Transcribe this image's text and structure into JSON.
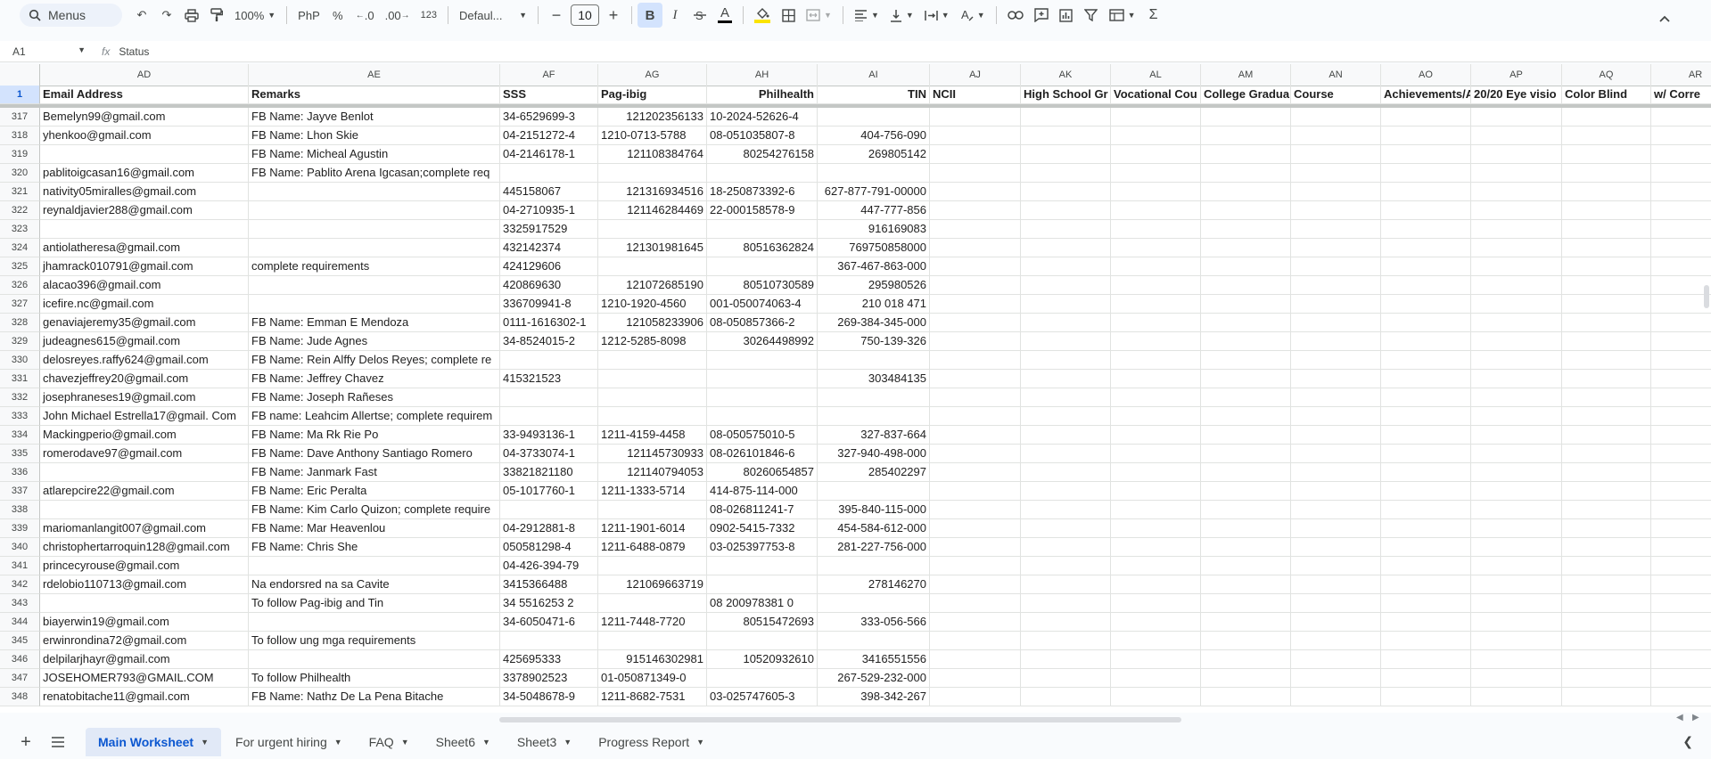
{
  "toolbar": {
    "menus_label": "Menus",
    "zoom": "100%",
    "currency": "PhP",
    "percent": "%",
    "dec_decrease": ".0",
    "dec_increase": ".00",
    "number_format": "123",
    "font_family": "Defaul...",
    "font_size": "10",
    "bold_label": "B",
    "italic_label": "I",
    "text_color_label": "A",
    "sum_label": "Σ"
  },
  "formula_bar": {
    "name_box": "A1",
    "fx_label": "fx",
    "content": "Status"
  },
  "columns": [
    "AD",
    "AE",
    "AF",
    "AG",
    "AH",
    "AI",
    "AJ",
    "AK",
    "AL",
    "AM",
    "AN",
    "AO",
    "AP",
    "AQ",
    "AR"
  ],
  "header_row": {
    "row_number": "1",
    "cells": [
      "Email Address",
      "Remarks",
      "SSS",
      "Pag-ibig",
      "Philhealth",
      "TIN",
      "NCII",
      "High School Gr",
      "Vocational Cou",
      "College Gradua",
      "Course",
      "Achievements/A",
      "20/20 Eye visio",
      "Color Blind",
      "w/ Corre"
    ]
  },
  "rows": [
    {
      "n": "317",
      "email": "Bemelyn99@gmail.com",
      "remarks": "FB Name: Jayve Benlot",
      "sss": "34-6529699-3",
      "pagibig": "121202356133",
      "philhealth": "10-2024-52626-4",
      "tin": ""
    },
    {
      "n": "318",
      "email": "yhenkoo@gmail.com",
      "remarks": "FB Name: Lhon Skie",
      "sss": "04-2151272-4",
      "pagibig": "1210-0713-5788",
      "philhealth": "08-051035807-8",
      "tin": "404-756-090"
    },
    {
      "n": "319",
      "email": "",
      "remarks": "FB Name: Micheal Agustin",
      "sss": "04-2146178-1",
      "pagibig": "121108384764",
      "philhealth": "80254276158",
      "tin": "269805142"
    },
    {
      "n": "320",
      "email": "pablitoigcasan16@gmail.com",
      "remarks": "FB Name: Pablito Arena Igcasan;complete req",
      "sss": "",
      "pagibig": "",
      "philhealth": "",
      "tin": ""
    },
    {
      "n": "321",
      "email": "nativity05miralles@gmail.com",
      "remarks": "",
      "sss": "445158067",
      "pagibig": "121316934516",
      "philhealth": "18-250873392-6",
      "tin": "627-877-791-00000"
    },
    {
      "n": "322",
      "email": "reynaldjavier288@gmail.com",
      "remarks": "",
      "sss": "04-2710935-1",
      "pagibig": "121146284469",
      "philhealth": "22-000158578-9",
      "tin": "447-777-856"
    },
    {
      "n": "323",
      "email": "",
      "remarks": "",
      "sss": "3325917529",
      "pagibig": "",
      "philhealth": "",
      "tin": "916169083"
    },
    {
      "n": "324",
      "email": "antiolatheresa@gmail.com",
      "remarks": "",
      "sss": "432142374",
      "pagibig": "121301981645",
      "philhealth": "80516362824",
      "tin": "769750858000"
    },
    {
      "n": "325",
      "email": "jhamrack010791@gmail.com",
      "remarks": "complete requirements",
      "sss": "424129606",
      "pagibig": "",
      "philhealth": "",
      "tin": "367-467-863-000"
    },
    {
      "n": "326",
      "email": "alacao396@gmail.com",
      "remarks": "",
      "sss": "420869630",
      "pagibig": "121072685190",
      "philhealth": "80510730589",
      "tin": "295980526"
    },
    {
      "n": "327",
      "email": "icefire.nc@gmail.com",
      "remarks": "",
      "sss": "336709941-8",
      "pagibig": "1210-1920-4560",
      "philhealth": "001-050074063-4",
      "tin": "210 018 471"
    },
    {
      "n": "328",
      "email": "genaviajeremy35@gmail.com",
      "remarks": "FB Name: Emman E Mendoza",
      "sss": "0111-1616302-1",
      "pagibig": "121058233906",
      "philhealth": "08-050857366-2",
      "tin": "269-384-345-000"
    },
    {
      "n": "329",
      "email": "judeagnes615@gmail.com",
      "remarks": "FB Name: Jude Agnes",
      "sss": "34-8524015-2",
      "pagibig": "1212-5285-8098",
      "philhealth": "30264498992",
      "tin": "750-139-326"
    },
    {
      "n": "330",
      "email": "delosreyes.raffy624@gmail.com",
      "remarks": "FB Name: Rein Alffy Delos Reyes; complete re",
      "sss": "",
      "pagibig": "",
      "philhealth": "",
      "tin": ""
    },
    {
      "n": "331",
      "email": "chavezjeffrey20@gmail.com",
      "remarks": "FB Name: Jeffrey Chavez",
      "sss": "415321523",
      "pagibig": "",
      "philhealth": "",
      "tin": "303484135"
    },
    {
      "n": "332",
      "email": "josephraneses19@gmail.com",
      "remarks": "FB Name: Joseph Rañeses",
      "sss": "",
      "pagibig": "",
      "philhealth": "",
      "tin": ""
    },
    {
      "n": "333",
      "email": "John Michael Estrella17@gmail. Com",
      "remarks": "FB name: Leahcim Allertse; complete requirem",
      "sss": "",
      "pagibig": "",
      "philhealth": "",
      "tin": ""
    },
    {
      "n": "334",
      "email": "Mackingperio@gmail.com",
      "remarks": "FB Name: Ma Rk Rie Po",
      "sss": "33-9493136-1",
      "pagibig": "1211-4159-4458",
      "philhealth": "08-050575010-5",
      "tin": "327-837-664"
    },
    {
      "n": "335",
      "email": "romerodave97@gmail.com",
      "remarks": "FB Name: Dave Anthony Santiago Romero",
      "sss": "04-3733074-1",
      "pagibig": "121145730933",
      "philhealth": "08-026101846-6",
      "tin": "327-940-498-000"
    },
    {
      "n": "336",
      "email": "",
      "remarks": "FB Name: Janmark Fast",
      "sss": "33821821180",
      "pagibig": "121140794053",
      "philhealth": "80260654857",
      "tin": "285402297"
    },
    {
      "n": "337",
      "email": "atlarepcire22@gmail.com",
      "remarks": "FB Name: Eric Peralta",
      "sss": "05-1017760-1",
      "pagibig": "1211-1333-5714",
      "philhealth": "414-875-114-000",
      "tin": ""
    },
    {
      "n": "338",
      "email": "",
      "remarks": "FB Name: Kim Carlo Quizon; complete require",
      "sss": "",
      "pagibig": "",
      "philhealth": "08-026811241-7",
      "tin": "395-840-115-000"
    },
    {
      "n": "339",
      "email": "mariomanlangit007@gmail.com",
      "remarks": "FB Name: Mar Heavenlou",
      "sss": "04-2912881-8",
      "pagibig": "1211-1901-6014",
      "philhealth": "0902-5415-7332",
      "tin": "454-584-612-000"
    },
    {
      "n": "340",
      "email": "christophertarroquin128@gmail.com",
      "remarks": "FB Name: Chris She",
      "sss": "050581298-4",
      "pagibig": "1211-6488-0879",
      "philhealth": "03-025397753-8",
      "tin": "281-227-756-000"
    },
    {
      "n": "341",
      "email": "princecyrouse@gmail.com",
      "remarks": "",
      "sss": "04-426-394-79",
      "pagibig": "",
      "philhealth": "",
      "tin": ""
    },
    {
      "n": "342",
      "email": "rdelobio110713@gmail.com",
      "remarks": "Na endorsred na sa Cavite",
      "sss": "3415366488",
      "pagibig": "121069663719",
      "philhealth": "",
      "tin": "278146270"
    },
    {
      "n": "343",
      "email": "",
      "remarks": "To follow Pag-ibig and Tin",
      "sss": "34 5516253 2",
      "pagibig": "",
      "philhealth": "08 200978381 0",
      "tin": ""
    },
    {
      "n": "344",
      "email": "biayerwin19@gmail.com",
      "remarks": "",
      "sss": "34-6050471-6",
      "pagibig": "1211-7448-7720",
      "philhealth": "80515472693",
      "tin": "333-056-566"
    },
    {
      "n": "345",
      "email": "erwinrondina72@gmail.com",
      "remarks": "To follow ung mga requirements",
      "sss": "",
      "pagibig": "",
      "philhealth": "",
      "tin": ""
    },
    {
      "n": "346",
      "email": "delpilarjhayr@gmail.com",
      "remarks": "",
      "sss": "425695333",
      "pagibig": "915146302981",
      "philhealth": "10520932610",
      "tin": "3416551556"
    },
    {
      "n": "347",
      "email": "JOSEHOMER793@GMAIL.COM",
      "remarks": "To follow Philhealth",
      "sss": "3378902523",
      "pagibig": "01-050871349-0",
      "philhealth": "",
      "tin": "267-529-232-000"
    },
    {
      "n": "348",
      "email": "renatobitache11@gmail.com",
      "remarks": "FB Name: Nathz De La Pena Bitache",
      "sss": "34-5048678-9",
      "pagibig": "1211-8682-7531",
      "philhealth": "03-025747605-3",
      "tin": "398-342-267"
    }
  ],
  "sheet_tabs": [
    {
      "label": "Main Worksheet",
      "active": true
    },
    {
      "label": "For urgent hiring",
      "active": false
    },
    {
      "label": "FAQ",
      "active": false
    },
    {
      "label": "Sheet6",
      "active": false
    },
    {
      "label": "Sheet3",
      "active": false
    },
    {
      "label": "Progress Report",
      "active": false
    }
  ],
  "icons": [
    "search-icon",
    "undo-icon",
    "redo-icon",
    "print-icon",
    "paint-format-icon",
    "bold-icon",
    "italic-icon",
    "strikethrough-icon",
    "text-color-icon",
    "fill-color-icon",
    "borders-icon",
    "merge-icon",
    "align-icon",
    "valign-icon",
    "wrap-icon",
    "rotate-icon",
    "link-icon",
    "comment-icon",
    "chart-icon",
    "filter-icon",
    "views-icon",
    "sum-icon",
    "chevron-up-icon",
    "add-sheet-icon",
    "all-sheets-icon"
  ],
  "colors": {
    "accent": "#0b57d0",
    "active_tab_bg": "#e1e9f7",
    "fill_color_bar": "#fbe400"
  }
}
